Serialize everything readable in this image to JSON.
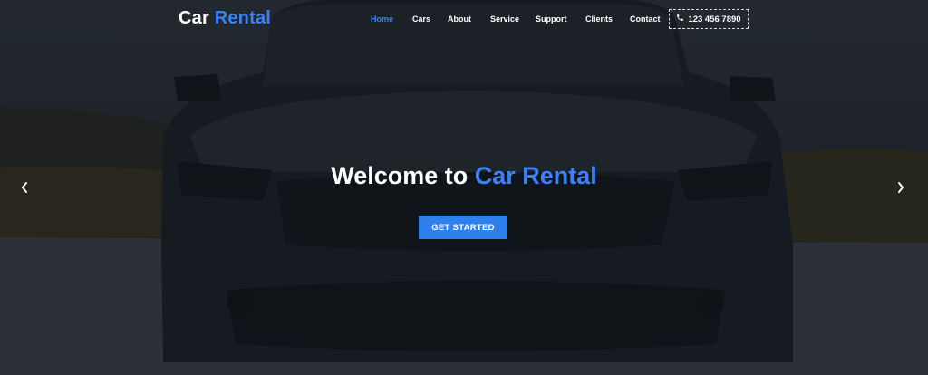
{
  "brand": {
    "name_part1": "Car",
    "name_part2": "Rental"
  },
  "nav": {
    "items": [
      {
        "label": "Home",
        "active": true
      },
      {
        "label": "Cars",
        "active": false
      },
      {
        "label": "About",
        "active": false
      },
      {
        "label": "Service",
        "active": false
      },
      {
        "label": "Support",
        "active": false
      },
      {
        "label": "Clients",
        "active": false
      },
      {
        "label": "Contact",
        "active": false
      }
    ],
    "phone": "123 456 7890"
  },
  "hero": {
    "headline_part1": "Welcome to",
    "headline_part2": "Car Rental",
    "cta_label": "GET STARTED",
    "background": "dark car front view on road"
  },
  "carousel": {
    "prev_icon": "chevron-left-icon",
    "next_icon": "chevron-right-icon"
  },
  "colors": {
    "accent": "#3b82f6",
    "button": "#2f80ed",
    "text": "#ffffff"
  }
}
